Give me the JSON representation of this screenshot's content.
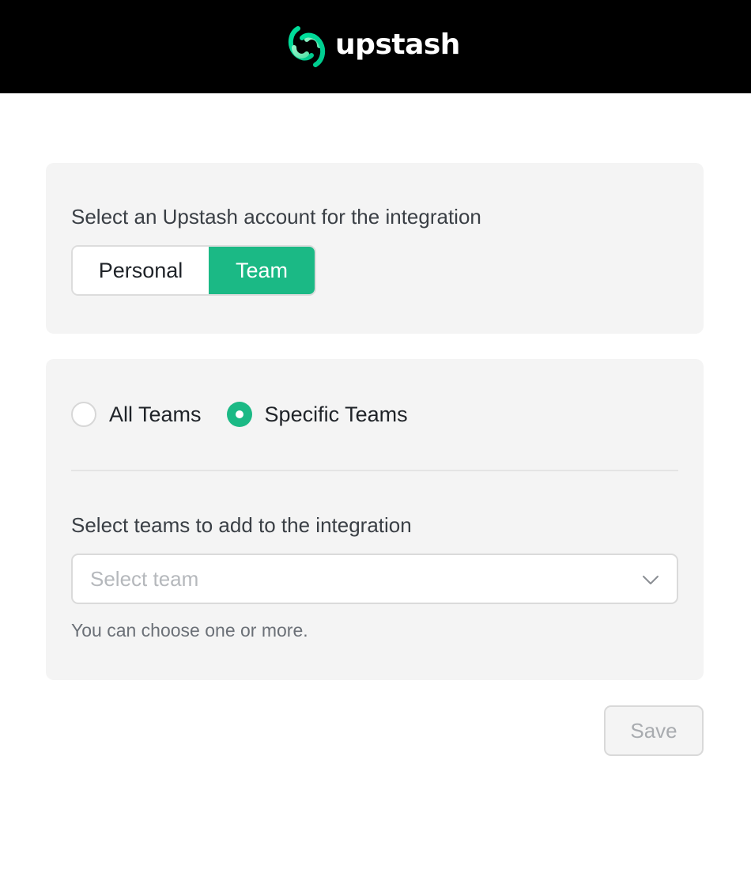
{
  "header": {
    "brand": "upstash",
    "logo_icon": "upstash-logo-icon",
    "background": "#000000"
  },
  "account_card": {
    "label": "Select an Upstash account for the integration",
    "options": [
      {
        "label": "Personal",
        "selected": false
      },
      {
        "label": "Team",
        "selected": true
      }
    ]
  },
  "teams_card": {
    "scope_options": [
      {
        "label": "All Teams",
        "selected": false
      },
      {
        "label": "Specific Teams",
        "selected": true
      }
    ],
    "label": "Select teams to add to the integration",
    "select": {
      "placeholder": "Select team",
      "icon": "chevron-down-icon"
    },
    "help": "You can choose one or more."
  },
  "actions": {
    "save_label": "Save",
    "save_disabled": true
  },
  "colors": {
    "accent": "#1bb985",
    "card_bg": "#f4f4f4",
    "border": "#dcdcdc"
  }
}
